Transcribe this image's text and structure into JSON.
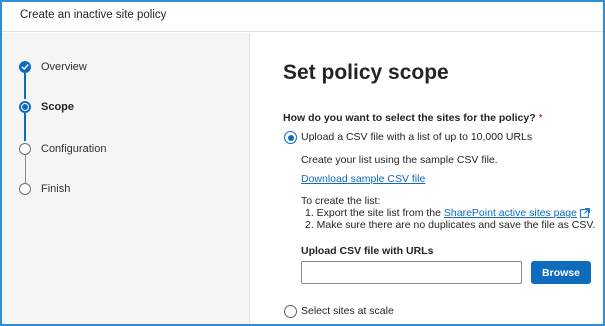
{
  "window": {
    "title": "Create an inactive site policy"
  },
  "steps": [
    {
      "label": "Overview",
      "state": "done"
    },
    {
      "label": "Scope",
      "state": "current"
    },
    {
      "label": "Configuration",
      "state": "todo"
    },
    {
      "label": "Finish",
      "state": "todo"
    }
  ],
  "main": {
    "heading": "Set policy scope",
    "question": "How do you want to select the sites for the policy?",
    "required_mark": "*",
    "options": [
      {
        "label": "Upload a CSV file with a list of up to 10,000 URLs",
        "selected": true
      },
      {
        "label": "Select sites at scale",
        "selected": false
      }
    ],
    "csv": {
      "hint": "Create your list using the sample CSV file.",
      "download_link": "Download sample CSV file",
      "instructions_title": "To create the list:",
      "instruction_1_prefix": "1. Export the site list from the",
      "instruction_1_link": "SharePoint active sites page",
      "instruction_2": "2. Make sure there are no duplicates and save the file as CSV.",
      "upload_label": "Upload CSV file with URLs",
      "upload_value": "",
      "browse_label": "Browse"
    }
  },
  "colors": {
    "accent": "#0f6cbd",
    "frame": "#2e8fd6",
    "required": "#c50f1f"
  },
  "icons": [
    "checkmark-icon",
    "external-link-icon"
  ]
}
